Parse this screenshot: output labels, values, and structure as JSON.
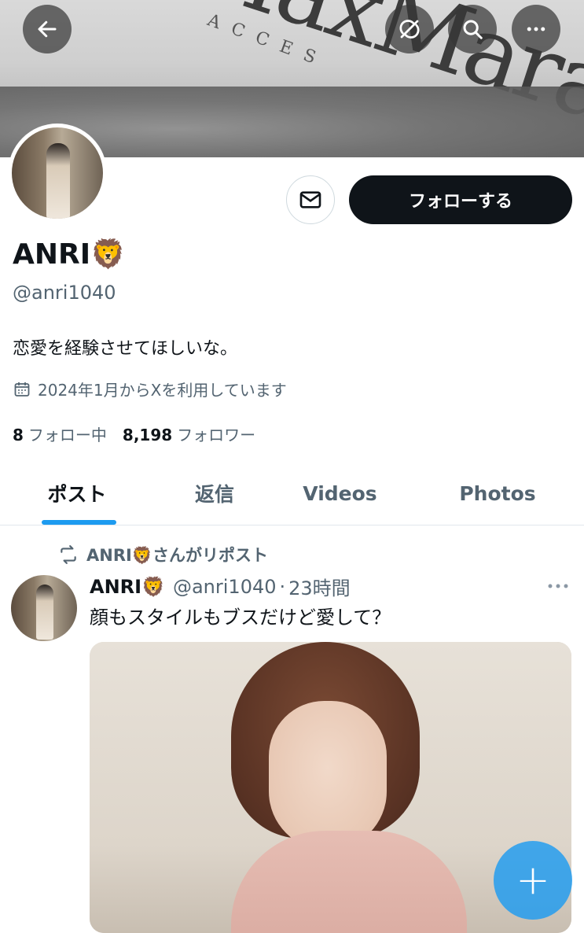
{
  "header": {
    "banner_text": "MaxMara",
    "banner_subtext": "ACCES"
  },
  "profile": {
    "name": "ANRI",
    "name_emoji": "🦁",
    "handle": "@anri1040",
    "bio": "恋愛を経験させてほしいな。",
    "joined": "2024年1月からXを利用しています",
    "following_count": "8",
    "following_label": "フォロー中",
    "followers_count": "8,198",
    "followers_label": "フォロワー",
    "follow_button_label": "フォローする"
  },
  "tabs": [
    {
      "label": "ポスト",
      "active": true
    },
    {
      "label": "返信",
      "active": false
    },
    {
      "label": "Videos",
      "active": false
    },
    {
      "label": "Photos",
      "active": false
    }
  ],
  "tweet": {
    "repost_label": "ANRI🦁さんがリポスト",
    "author_name": "ANRI",
    "author_emoji": "🦁",
    "author_handle": "@anri1040",
    "separator": "·",
    "time": "23時間",
    "text": "顔もスタイルもブスだけど愛して？"
  },
  "fab": {
    "label": "+"
  },
  "icons": {
    "back": "back-arrow-icon",
    "no_sync": "no-sync-icon",
    "search": "search-icon",
    "more": "more-icon",
    "mail": "mail-icon",
    "calendar": "calendar-icon",
    "repost": "repost-icon"
  },
  "colors": {
    "accent": "#1d9bf0",
    "text_primary": "#0f1419",
    "text_secondary": "#536471",
    "follow_button_bg": "#0f1419"
  }
}
